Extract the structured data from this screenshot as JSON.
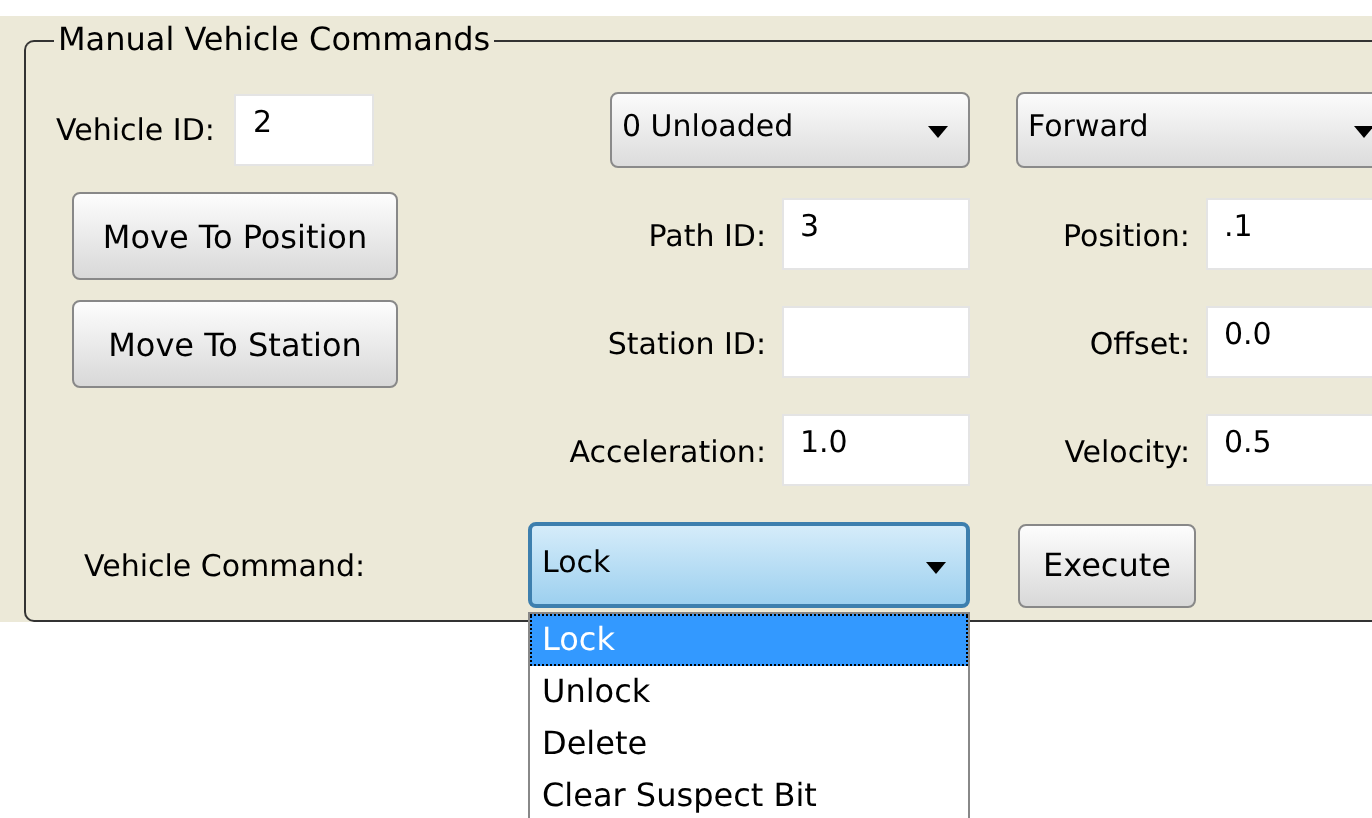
{
  "group": {
    "title": "Manual Vehicle Commands"
  },
  "vehicle_id": {
    "label": "Vehicle ID:",
    "value": "2"
  },
  "load_dropdown": {
    "value": "0 Unloaded"
  },
  "direction_dropdown": {
    "value": "Forward"
  },
  "buttons": [
    {
      "label": "Move To Position"
    },
    {
      "label": "Move To Station"
    }
  ],
  "fields": [
    {
      "label": "Path ID:",
      "value": "3"
    },
    {
      "label": "Position:",
      "value": ".1"
    },
    {
      "label": "Station ID:"
    },
    {
      "label": "Offset:",
      "value": "0.0"
    },
    {
      "label": "Acceleration:",
      "value": "1.0"
    },
    {
      "label": "Velocity:",
      "value": "0.5"
    }
  ],
  "command": {
    "label": "Vehicle Command:",
    "value": "Lock",
    "open": true,
    "options": [
      {
        "label": "Lock",
        "selected": true
      },
      {
        "label": "Unlock",
        "selected": false
      },
      {
        "label": "Delete",
        "selected": false
      },
      {
        "label": "Clear Suspect Bit",
        "selected": false
      }
    ]
  },
  "execute_button": {
    "label": "Execute"
  }
}
